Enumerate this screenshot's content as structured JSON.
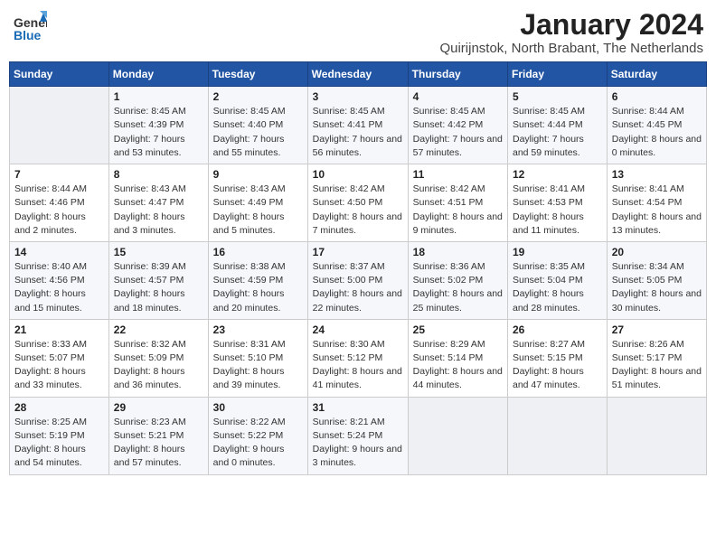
{
  "header": {
    "logo_general": "General",
    "logo_blue": "Blue",
    "month_title": "January 2024",
    "location": "Quirijnstok, North Brabant, The Netherlands"
  },
  "weekdays": [
    "Sunday",
    "Monday",
    "Tuesday",
    "Wednesday",
    "Thursday",
    "Friday",
    "Saturday"
  ],
  "weeks": [
    [
      {
        "day": "",
        "sunrise": "",
        "sunset": "",
        "daylight": ""
      },
      {
        "day": "1",
        "sunrise": "Sunrise: 8:45 AM",
        "sunset": "Sunset: 4:39 PM",
        "daylight": "Daylight: 7 hours and 53 minutes."
      },
      {
        "day": "2",
        "sunrise": "Sunrise: 8:45 AM",
        "sunset": "Sunset: 4:40 PM",
        "daylight": "Daylight: 7 hours and 55 minutes."
      },
      {
        "day": "3",
        "sunrise": "Sunrise: 8:45 AM",
        "sunset": "Sunset: 4:41 PM",
        "daylight": "Daylight: 7 hours and 56 minutes."
      },
      {
        "day": "4",
        "sunrise": "Sunrise: 8:45 AM",
        "sunset": "Sunset: 4:42 PM",
        "daylight": "Daylight: 7 hours and 57 minutes."
      },
      {
        "day": "5",
        "sunrise": "Sunrise: 8:45 AM",
        "sunset": "Sunset: 4:44 PM",
        "daylight": "Daylight: 7 hours and 59 minutes."
      },
      {
        "day": "6",
        "sunrise": "Sunrise: 8:44 AM",
        "sunset": "Sunset: 4:45 PM",
        "daylight": "Daylight: 8 hours and 0 minutes."
      }
    ],
    [
      {
        "day": "7",
        "sunrise": "Sunrise: 8:44 AM",
        "sunset": "Sunset: 4:46 PM",
        "daylight": "Daylight: 8 hours and 2 minutes."
      },
      {
        "day": "8",
        "sunrise": "Sunrise: 8:43 AM",
        "sunset": "Sunset: 4:47 PM",
        "daylight": "Daylight: 8 hours and 3 minutes."
      },
      {
        "day": "9",
        "sunrise": "Sunrise: 8:43 AM",
        "sunset": "Sunset: 4:49 PM",
        "daylight": "Daylight: 8 hours and 5 minutes."
      },
      {
        "day": "10",
        "sunrise": "Sunrise: 8:42 AM",
        "sunset": "Sunset: 4:50 PM",
        "daylight": "Daylight: 8 hours and 7 minutes."
      },
      {
        "day": "11",
        "sunrise": "Sunrise: 8:42 AM",
        "sunset": "Sunset: 4:51 PM",
        "daylight": "Daylight: 8 hours and 9 minutes."
      },
      {
        "day": "12",
        "sunrise": "Sunrise: 8:41 AM",
        "sunset": "Sunset: 4:53 PM",
        "daylight": "Daylight: 8 hours and 11 minutes."
      },
      {
        "day": "13",
        "sunrise": "Sunrise: 8:41 AM",
        "sunset": "Sunset: 4:54 PM",
        "daylight": "Daylight: 8 hours and 13 minutes."
      }
    ],
    [
      {
        "day": "14",
        "sunrise": "Sunrise: 8:40 AM",
        "sunset": "Sunset: 4:56 PM",
        "daylight": "Daylight: 8 hours and 15 minutes."
      },
      {
        "day": "15",
        "sunrise": "Sunrise: 8:39 AM",
        "sunset": "Sunset: 4:57 PM",
        "daylight": "Daylight: 8 hours and 18 minutes."
      },
      {
        "day": "16",
        "sunrise": "Sunrise: 8:38 AM",
        "sunset": "Sunset: 4:59 PM",
        "daylight": "Daylight: 8 hours and 20 minutes."
      },
      {
        "day": "17",
        "sunrise": "Sunrise: 8:37 AM",
        "sunset": "Sunset: 5:00 PM",
        "daylight": "Daylight: 8 hours and 22 minutes."
      },
      {
        "day": "18",
        "sunrise": "Sunrise: 8:36 AM",
        "sunset": "Sunset: 5:02 PM",
        "daylight": "Daylight: 8 hours and 25 minutes."
      },
      {
        "day": "19",
        "sunrise": "Sunrise: 8:35 AM",
        "sunset": "Sunset: 5:04 PM",
        "daylight": "Daylight: 8 hours and 28 minutes."
      },
      {
        "day": "20",
        "sunrise": "Sunrise: 8:34 AM",
        "sunset": "Sunset: 5:05 PM",
        "daylight": "Daylight: 8 hours and 30 minutes."
      }
    ],
    [
      {
        "day": "21",
        "sunrise": "Sunrise: 8:33 AM",
        "sunset": "Sunset: 5:07 PM",
        "daylight": "Daylight: 8 hours and 33 minutes."
      },
      {
        "day": "22",
        "sunrise": "Sunrise: 8:32 AM",
        "sunset": "Sunset: 5:09 PM",
        "daylight": "Daylight: 8 hours and 36 minutes."
      },
      {
        "day": "23",
        "sunrise": "Sunrise: 8:31 AM",
        "sunset": "Sunset: 5:10 PM",
        "daylight": "Daylight: 8 hours and 39 minutes."
      },
      {
        "day": "24",
        "sunrise": "Sunrise: 8:30 AM",
        "sunset": "Sunset: 5:12 PM",
        "daylight": "Daylight: 8 hours and 41 minutes."
      },
      {
        "day": "25",
        "sunrise": "Sunrise: 8:29 AM",
        "sunset": "Sunset: 5:14 PM",
        "daylight": "Daylight: 8 hours and 44 minutes."
      },
      {
        "day": "26",
        "sunrise": "Sunrise: 8:27 AM",
        "sunset": "Sunset: 5:15 PM",
        "daylight": "Daylight: 8 hours and 47 minutes."
      },
      {
        "day": "27",
        "sunrise": "Sunrise: 8:26 AM",
        "sunset": "Sunset: 5:17 PM",
        "daylight": "Daylight: 8 hours and 51 minutes."
      }
    ],
    [
      {
        "day": "28",
        "sunrise": "Sunrise: 8:25 AM",
        "sunset": "Sunset: 5:19 PM",
        "daylight": "Daylight: 8 hours and 54 minutes."
      },
      {
        "day": "29",
        "sunrise": "Sunrise: 8:23 AM",
        "sunset": "Sunset: 5:21 PM",
        "daylight": "Daylight: 8 hours and 57 minutes."
      },
      {
        "day": "30",
        "sunrise": "Sunrise: 8:22 AM",
        "sunset": "Sunset: 5:22 PM",
        "daylight": "Daylight: 9 hours and 0 minutes."
      },
      {
        "day": "31",
        "sunrise": "Sunrise: 8:21 AM",
        "sunset": "Sunset: 5:24 PM",
        "daylight": "Daylight: 9 hours and 3 minutes."
      },
      {
        "day": "",
        "sunrise": "",
        "sunset": "",
        "daylight": ""
      },
      {
        "day": "",
        "sunrise": "",
        "sunset": "",
        "daylight": ""
      },
      {
        "day": "",
        "sunrise": "",
        "sunset": "",
        "daylight": ""
      }
    ]
  ]
}
